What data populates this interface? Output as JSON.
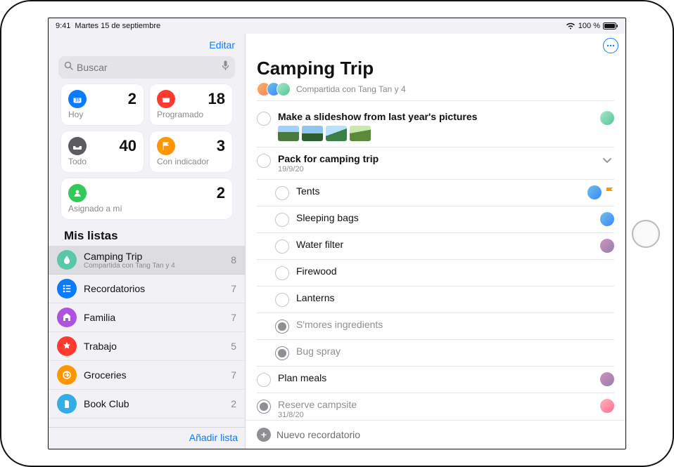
{
  "status": {
    "time": "9:41",
    "date": "Martes 15 de septiembre",
    "battery_text": "100 %"
  },
  "sidebar": {
    "edit_label": "Editar",
    "search_placeholder": "Buscar",
    "smart": {
      "today": {
        "label": "Hoy",
        "count": "2"
      },
      "scheduled": {
        "label": "Programado",
        "count": "18"
      },
      "all": {
        "label": "Todo",
        "count": "40"
      },
      "flagged": {
        "label": "Con indicador",
        "count": "3"
      },
      "assigned": {
        "label": "Asignado a mí",
        "count": "2"
      }
    },
    "section_title": "Mis listas",
    "lists": [
      {
        "name": "Camping Trip",
        "sub": "Compartida con Tang Tan y 4",
        "count": "8",
        "color": "ic-teal",
        "selected": true
      },
      {
        "name": "Recordatorios",
        "sub": "",
        "count": "7",
        "color": "ic-blue",
        "selected": false
      },
      {
        "name": "Familia",
        "sub": "",
        "count": "7",
        "color": "ic-purple",
        "selected": false
      },
      {
        "name": "Trabajo",
        "sub": "",
        "count": "5",
        "color": "ic-redl",
        "selected": false
      },
      {
        "name": "Groceries",
        "sub": "",
        "count": "7",
        "color": "ic-orange",
        "selected": false
      },
      {
        "name": "Book Club",
        "sub": "",
        "count": "2",
        "color": "ic-cyan",
        "selected": false
      }
    ],
    "add_list_label": "Añadir lista"
  },
  "main": {
    "title": "Camping Trip",
    "shared_text": "Compartida con Tang Tan y 4",
    "new_reminder_label": "Nuevo recordatorio",
    "reminders": [
      {
        "title": "Make a slideshow from last year's pictures",
        "bold": true,
        "done": false,
        "sub": "",
        "thumbs": 4,
        "assignee": "av3",
        "flag": false,
        "chevron": false,
        "level": 0
      },
      {
        "title": "Pack for camping trip",
        "bold": true,
        "done": false,
        "sub": "19/9/20",
        "thumbs": 0,
        "assignee": "",
        "flag": false,
        "chevron": true,
        "level": 0
      },
      {
        "title": "Tents",
        "bold": false,
        "done": false,
        "sub": "",
        "thumbs": 0,
        "assignee": "av2",
        "flag": true,
        "chevron": false,
        "level": 1
      },
      {
        "title": "Sleeping bags",
        "bold": false,
        "done": false,
        "sub": "",
        "thumbs": 0,
        "assignee": "av2",
        "flag": false,
        "chevron": false,
        "level": 1
      },
      {
        "title": "Water filter",
        "bold": false,
        "done": false,
        "sub": "",
        "thumbs": 0,
        "assignee": "av4",
        "flag": false,
        "chevron": false,
        "level": 1
      },
      {
        "title": "Firewood",
        "bold": false,
        "done": false,
        "sub": "",
        "thumbs": 0,
        "assignee": "",
        "flag": false,
        "chevron": false,
        "level": 1
      },
      {
        "title": "Lanterns",
        "bold": false,
        "done": false,
        "sub": "",
        "thumbs": 0,
        "assignee": "",
        "flag": false,
        "chevron": false,
        "level": 1
      },
      {
        "title": "S'mores ingredients",
        "bold": false,
        "done": true,
        "sub": "",
        "thumbs": 0,
        "assignee": "",
        "flag": false,
        "chevron": false,
        "level": 1
      },
      {
        "title": "Bug spray",
        "bold": false,
        "done": true,
        "sub": "",
        "thumbs": 0,
        "assignee": "",
        "flag": false,
        "chevron": false,
        "level": 1
      },
      {
        "title": "Plan meals",
        "bold": false,
        "done": false,
        "sub": "",
        "thumbs": 0,
        "assignee": "av4",
        "flag": false,
        "chevron": false,
        "level": 0
      },
      {
        "title": "Reserve campsite",
        "bold": false,
        "done": true,
        "sub": "31/8/20",
        "thumbs": 0,
        "assignee": "av5",
        "flag": false,
        "chevron": false,
        "level": 0
      }
    ]
  }
}
